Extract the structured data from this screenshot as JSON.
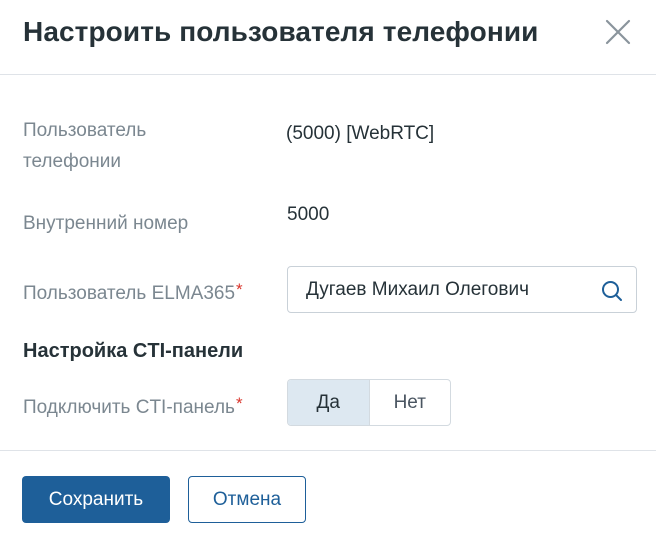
{
  "dialog": {
    "title": "Настроить пользователя телефонии",
    "close_icon": "close-icon"
  },
  "form": {
    "telephony_user": {
      "label_line1": "Пользователь",
      "label_line2": "телефонии",
      "value": "(5000) [WebRTC]"
    },
    "extension": {
      "label": "Внутренний номер",
      "value": "5000"
    },
    "elma_user": {
      "label": "Пользователь ELMA365",
      "required_mark": "*",
      "value": "Дугаев Михаил Олегович",
      "icon": "search-icon"
    },
    "cti_section": {
      "title": "Настройка CTI-панели"
    },
    "cti_connect": {
      "label": "Подключить CTI-панель",
      "required_mark": "*",
      "options": [
        "Да",
        "Нет"
      ],
      "selected": "Да"
    }
  },
  "footer": {
    "save_label": "Сохранить",
    "cancel_label": "Отмена"
  },
  "colors": {
    "primary": "#1e5f99",
    "required": "#d9342b",
    "toggle_active_bg": "#dde8f1",
    "label": "#7b8790",
    "text": "#263238"
  }
}
